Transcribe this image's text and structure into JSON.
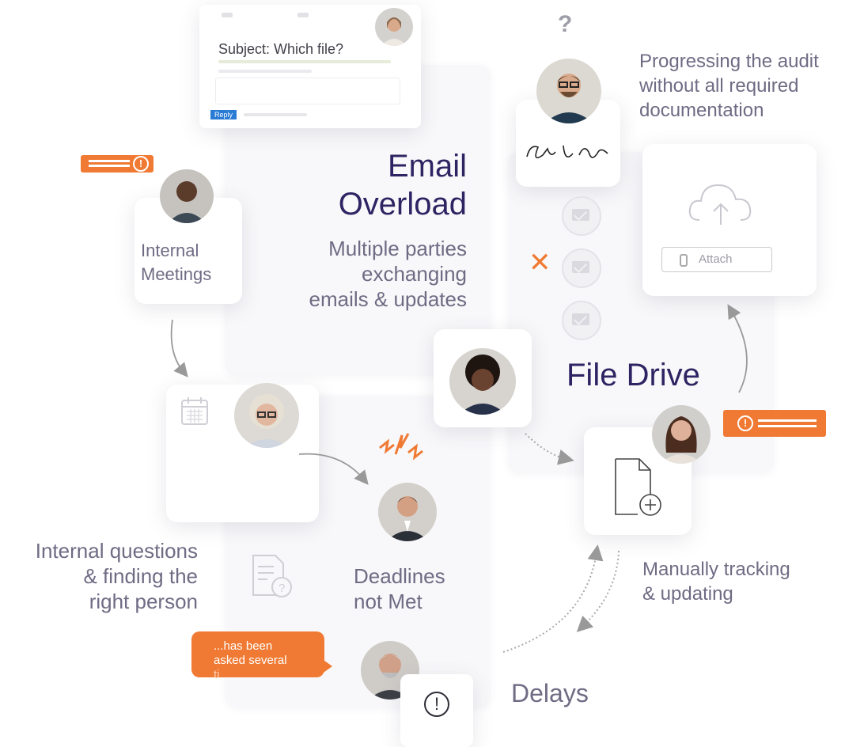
{
  "email_card": {
    "subject": "Subject: Which file?",
    "reply_label": "Reply"
  },
  "email_overload": {
    "title_line1": "Email",
    "title_line2": "Overload",
    "desc_line1": "Multiple parties",
    "desc_line2": "exchanging",
    "desc_line3": "emails & updates"
  },
  "internal_meetings": {
    "line1": "Internal",
    "line2": "Meetings"
  },
  "audit": {
    "line1": "Progressing the audit",
    "line2": "without all required",
    "line3": "documentation"
  },
  "question_mark": "?",
  "attach_label": "Attach",
  "file_drive": "File Drive",
  "internal_questions": {
    "line1": "Internal questions",
    "line2": "& finding the",
    "line3": "right person"
  },
  "deadlines": {
    "line1": "Deadlines",
    "line2": "not Met"
  },
  "manual": {
    "line1": "Manually tracking",
    "line2": "& updating"
  },
  "delays": "Delays",
  "speech_bubble": {
    "line1": "...has been",
    "line2": "asked several",
    "line3": "ti"
  },
  "alert_symbol": "!",
  "x_mark": "✕",
  "colors": {
    "accent": "#f07a33",
    "title": "#2e2463",
    "text": "#6f6b84",
    "reply_button": "#2a7bd4"
  }
}
